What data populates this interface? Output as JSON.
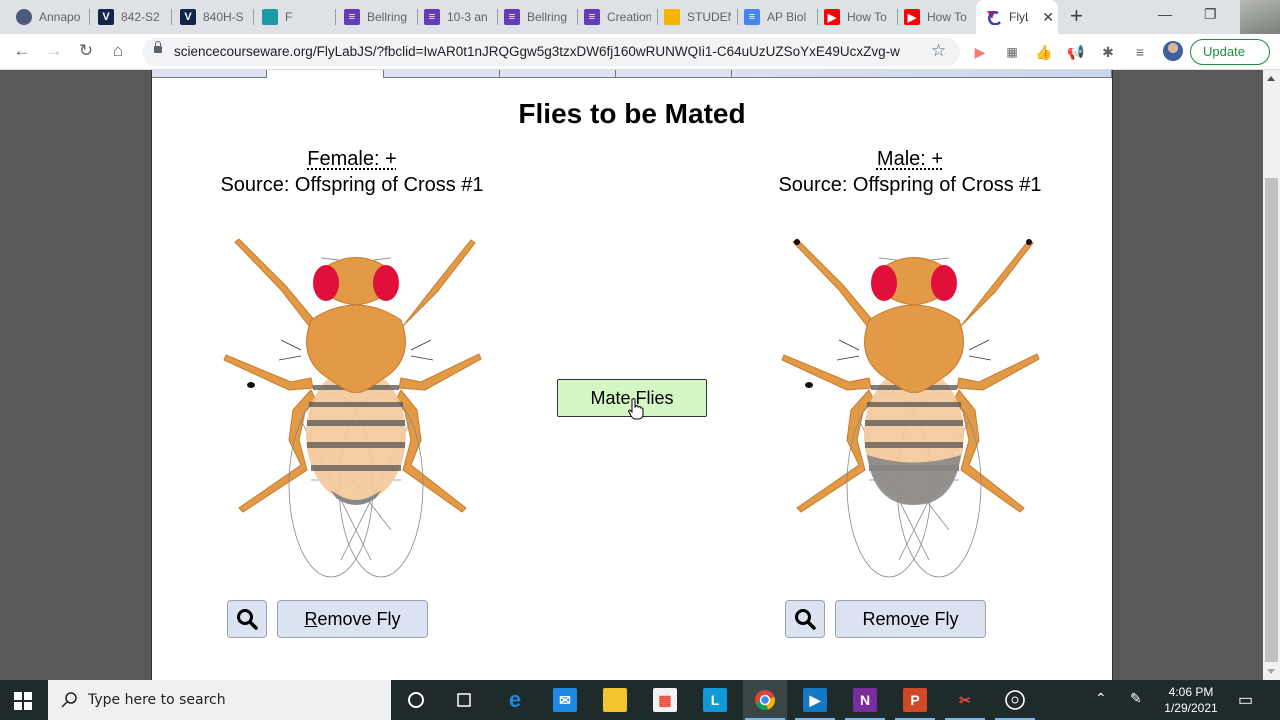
{
  "browser": {
    "tabs": [
      {
        "label": "Annapo",
        "icon": "annapolis-icon",
        "color": "#4a5a7a"
      },
      {
        "label": "842-S2",
        "icon": "v-icon",
        "color": "#14244a"
      },
      {
        "label": "840H-S",
        "icon": "v-icon",
        "color": "#14244a"
      },
      {
        "label": "F",
        "icon": "classroom-icon",
        "color": "#1a9aa5"
      },
      {
        "label": "Bellring",
        "icon": "forms-icon",
        "color": "#673ab7"
      },
      {
        "label": "10-3 an",
        "icon": "forms-icon",
        "color": "#673ab7"
      },
      {
        "label": "Bellring",
        "icon": "forms-icon",
        "color": "#673ab7"
      },
      {
        "label": "Creation",
        "icon": "forms-icon",
        "color": "#673ab7"
      },
      {
        "label": "STUDEN",
        "icon": "slides-icon",
        "color": "#f4b400"
      },
      {
        "label": "AP Biol",
        "icon": "docs-icon",
        "color": "#4285f4"
      },
      {
        "label": "How To",
        "icon": "youtube-icon",
        "color": "#ff0000"
      },
      {
        "label": "How To",
        "icon": "youtube-icon",
        "color": "#ff0000"
      }
    ],
    "active_tab": {
      "label": "FlyL",
      "icon": "flylab-icon"
    },
    "url": "sciencecourseware.org/FlyLabJS/?fbclid=IwAR0t1nJRQGgw5g3tzxDW6fj160wRUNWQIi1-C64uUzUZSoYxE49UcxZvg-w",
    "update_label": "Update"
  },
  "page": {
    "title": "Flies to be Mated",
    "female": {
      "label": "Female: +",
      "source": "Source: Offspring of Cross #1"
    },
    "male": {
      "label": "Male: +",
      "source": "Source: Offspring of Cross #1"
    },
    "mate_button": "Mate Flies",
    "remove_female": {
      "underline": "R",
      "rest": "emove Fly"
    },
    "remove_male": {
      "pre": "Remo",
      "underline": "v",
      "rest": "e Fly"
    },
    "colors": {
      "body": "#e29a47",
      "eye": "#e0103a",
      "mate_button_bg": "#d4f7c4",
      "button_bg": "#dbe2f0"
    }
  },
  "taskbar": {
    "search_placeholder": "Type here to search",
    "time": "4:06 PM",
    "date": "1/29/2021"
  }
}
